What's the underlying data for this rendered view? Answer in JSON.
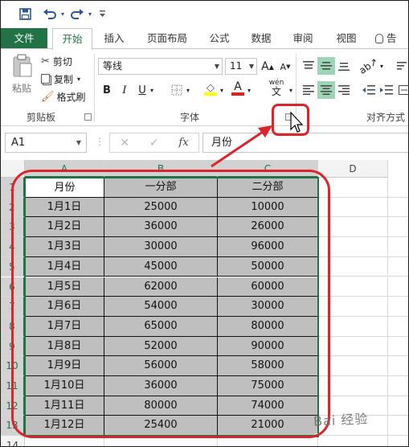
{
  "qat": {
    "icons": [
      "save-icon",
      "undo-icon",
      "redo-icon",
      "customize-qat-icon"
    ]
  },
  "tabs": [
    {
      "label": "文件"
    },
    {
      "label": "开始"
    },
    {
      "label": "插入"
    },
    {
      "label": "页面布局"
    },
    {
      "label": "公式"
    },
    {
      "label": "数据"
    },
    {
      "label": "审阅"
    },
    {
      "label": "视图"
    },
    {
      "label": "告"
    }
  ],
  "ribbon": {
    "clipboard": {
      "paste": "粘贴",
      "cut": "剪切",
      "copy": "复制",
      "format_painter": "格式刷",
      "group_label": "剪贴板"
    },
    "font": {
      "font_name": "等线",
      "font_size": "11",
      "grow": "A",
      "shrink": "A",
      "bold": "B",
      "italic": "I",
      "underline": "U",
      "font_color": "A",
      "phonetic": "wén",
      "phonetic_char": "文",
      "group_label": "字体",
      "highlight_color": "#ffff00",
      "font_color_value": "#e02020"
    },
    "alignment": {
      "group_label": "对齐方式"
    }
  },
  "formula_bar": {
    "name_box": "A1",
    "fx": "fx",
    "cancel": "✕",
    "enter": "✓",
    "value": "月份"
  },
  "sheet": {
    "columns": [
      "A",
      "B",
      "C",
      "D"
    ],
    "rows": [
      "1",
      "2",
      "3",
      "4",
      "5",
      "6",
      "7",
      "8",
      "9",
      "10",
      "11",
      "12",
      "13",
      "14"
    ],
    "headers": [
      "月份",
      "一分部",
      "二分部"
    ],
    "data": [
      [
        "1月1日",
        "25000",
        "10000"
      ],
      [
        "1月2日",
        "36000",
        "26000"
      ],
      [
        "1月3日",
        "30000",
        "96000"
      ],
      [
        "1月4日",
        "45000",
        "50000"
      ],
      [
        "1月5日",
        "62000",
        "60000"
      ],
      [
        "1月6日",
        "54000",
        "30000"
      ],
      [
        "1月7日",
        "65000",
        "80000"
      ],
      [
        "1月8日",
        "52000",
        "90000"
      ],
      [
        "1月9日",
        "56000",
        "58000"
      ],
      [
        "1月10日",
        "36000",
        "75000"
      ],
      [
        "1月11日",
        "80000",
        "74000"
      ],
      [
        "1月12日",
        "25400",
        "21000"
      ]
    ]
  },
  "colors": {
    "excel_green": "#217346",
    "annotation_red": "#d9262a",
    "data_fill": "#bfbfbf"
  },
  "watermark": "Bai 经验"
}
